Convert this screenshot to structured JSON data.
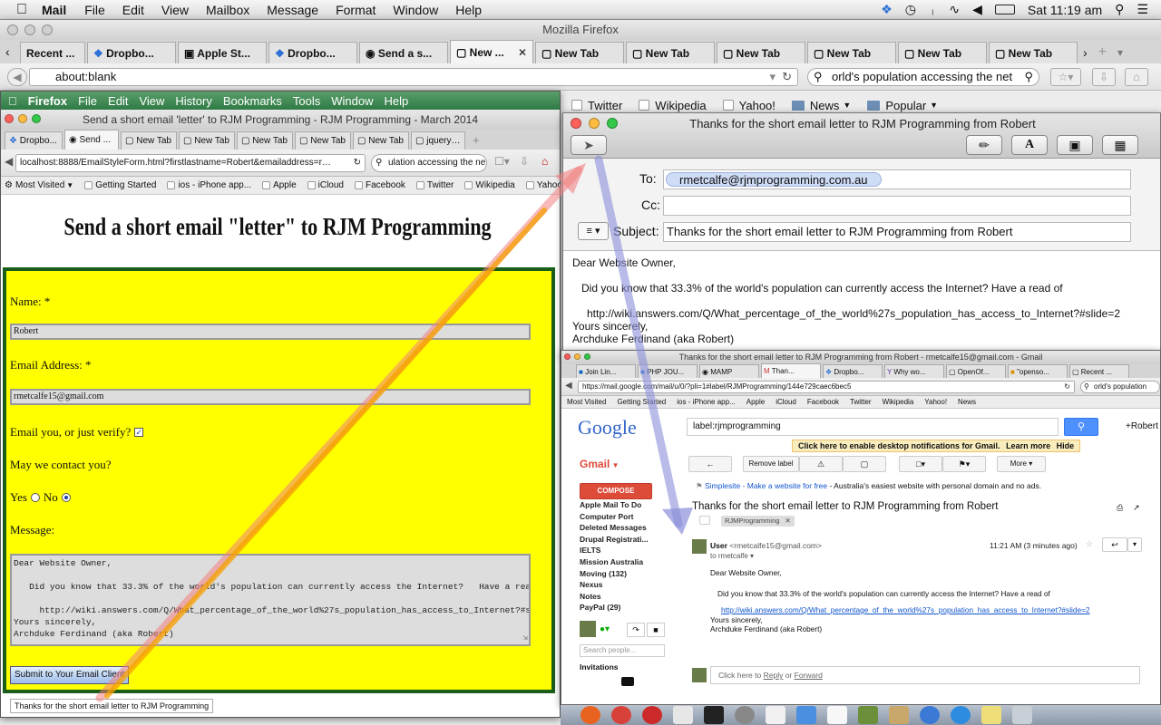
{
  "menubar": {
    "app": "Mail",
    "items": [
      "File",
      "Edit",
      "View",
      "Mailbox",
      "Message",
      "Format",
      "Window",
      "Help"
    ],
    "clock": "Sat 11:19 am"
  },
  "firefox": {
    "title": "Mozilla Firefox",
    "tabs": [
      "Recent ...",
      "Dropbo...",
      "Apple St...",
      "Dropbo...",
      "Send a s...",
      "New ...",
      "New Tab",
      "New Tab",
      "New Tab",
      "New Tab",
      "New Tab",
      "New Tab"
    ],
    "url": "about:blank",
    "search": "orld's population accessing the net",
    "bookmarks": [
      "Twitter",
      "Wikipedia",
      "Yahoo!",
      "News",
      "Popular"
    ]
  },
  "inner": {
    "menubar": {
      "app": "Firefox",
      "items": [
        "File",
        "Edit",
        "View",
        "History",
        "Bookmarks",
        "Tools",
        "Window",
        "Help"
      ]
    },
    "title": "Send a short email 'letter' to RJM Programming - RJM Programming - March 2014",
    "tabs": [
      "Dropbo...",
      "Send ...",
      "New Tab",
      "New Tab",
      "New Tab",
      "New Tab",
      "New Tab",
      "jquery -..."
    ],
    "url": "localhost:8888/EmailStyleForm.html?firstlastname=Robert&emailaddress=rmetcalfe15",
    "search": "ulation accessing the ne",
    "bookmarks": [
      "Most Visited",
      "Getting Started",
      "ios - iPhone app...",
      "Apple",
      "iCloud",
      "Facebook",
      "Twitter",
      "Wikipedia",
      "Yahoo!"
    ]
  },
  "form": {
    "heading": "Send a short email \"letter\" to RJM Programming",
    "name_label": "Name: *",
    "name_value": "Robert",
    "email_label": "Email Address: *",
    "email_value": "rmetcalfe15@gmail.com",
    "verify_label": "Email you, or just verify?",
    "contact_label": "May we contact you?",
    "yes_label": "Yes",
    "no_label": "No",
    "message_label": "Message:",
    "message_value": "Dear Website Owner,\n\n   Did you know that 33.3% of the world's population can currently access the Internet?   Have a read of\n\n     http://wiki.answers.com/Q/What_percentage_of_the_world%27s_population_has_access_to_Internet?#slide=2\nYours sincerely,\nArchduke Ferdinand (aka Robert)",
    "submit_label": "Submit to Your Email Client",
    "status_text": "Thanks for the short email letter to RJM Programming"
  },
  "compose": {
    "title": "Thanks for the short email letter to RJM Programming from Robert",
    "to_label": "To:",
    "to_value": "rmetcalfe@rjmprogramming.com.au",
    "cc_label": "Cc:",
    "subject_label": "Subject:",
    "subject_value": "Thanks for the short email letter to RJM Programming from Robert",
    "body": [
      "Dear Website Owner,",
      "Did you know that 33.3% of the world's population can currently access the Internet?   Have a read of",
      "http://wiki.answers.com/Q/What_percentage_of_the_world%27s_population_has_access_to_Internet?#slide=2",
      "Yours sincerely,",
      "Archduke Ferdinand (aka Robert)"
    ]
  },
  "gmail": {
    "title": "Thanks for the short email letter to RJM Programming from Robert - rmetcalfe15@gmail.com - Gmail",
    "tabs": [
      "Join Lin...",
      "PHP JOU...",
      "MAMP",
      "Than...",
      "Dropbo...",
      "Why wo...",
      "OpenOf...",
      "\"openso...",
      "Recent ..."
    ],
    "url": "https://mail.google.com/mail/u/0/?pli=1#label/RJMProgramming/144e729caec6bec5",
    "search": "orld's population",
    "bookmarks": [
      "Most Visited",
      "Getting Started",
      "ios - iPhone app...",
      "Apple",
      "iCloud",
      "Facebook",
      "Twitter",
      "Wikipedia",
      "Yahoo!",
      "News"
    ],
    "logo": "Google",
    "search_query": "label:rjmprogramming",
    "user": "+Robert",
    "notify": "Click here to enable desktop notifications for Gmail.",
    "learn_more": "Learn more",
    "hide": "Hide",
    "gmail_label": "Gmail",
    "remove_label": "Remove label",
    "more": "More",
    "compose": "COMPOSE",
    "folders": [
      "Apple Mail To Do",
      "Computer Port",
      "Deleted Messages",
      "Drupal Registrati...",
      "IELTS",
      "Mission Australia",
      "Moving (132)",
      "Nexus",
      "Notes",
      "PayPal (29)"
    ],
    "search_people": "Search people...",
    "invitations": "Invitations",
    "ad_link": "Simplesite - Make a website for free",
    "ad_text": " - Australia's easiest website with personal domain and no ads.",
    "subject": "Thanks for the short email letter to RJM Programming from Robert",
    "label_chip": "RJMProgramming",
    "sender": "User",
    "sender_email": "<rmetcalfe15@gmail.com>",
    "time": "11:21 AM (3 minutes ago)",
    "to": "to rmetcalfe",
    "body": [
      "Dear Website Owner,",
      "Did you know that 33.3% of the world's population can currently access the Internet?   Have a read of",
      "http://wiki.answers.com/Q/What_percentage_of_the_world%27s_population_has_access_to_Internet?#slide=2",
      "Yours sincerely,",
      "Archduke Ferdinand (aka Robert)"
    ],
    "reply_prefix": "Click here to ",
    "reply": "Reply",
    "or": " or ",
    "forward": "Forward"
  },
  "colors": {
    "form_bg": "#ffff00",
    "form_border": "#1a5c1a",
    "gmail_red": "#dd4b39",
    "gmail_blue": "#4d90fe",
    "arrow_red": "#f08080",
    "arrow_orange": "#f5a000",
    "arrow_blue": "#8a8fd8"
  }
}
